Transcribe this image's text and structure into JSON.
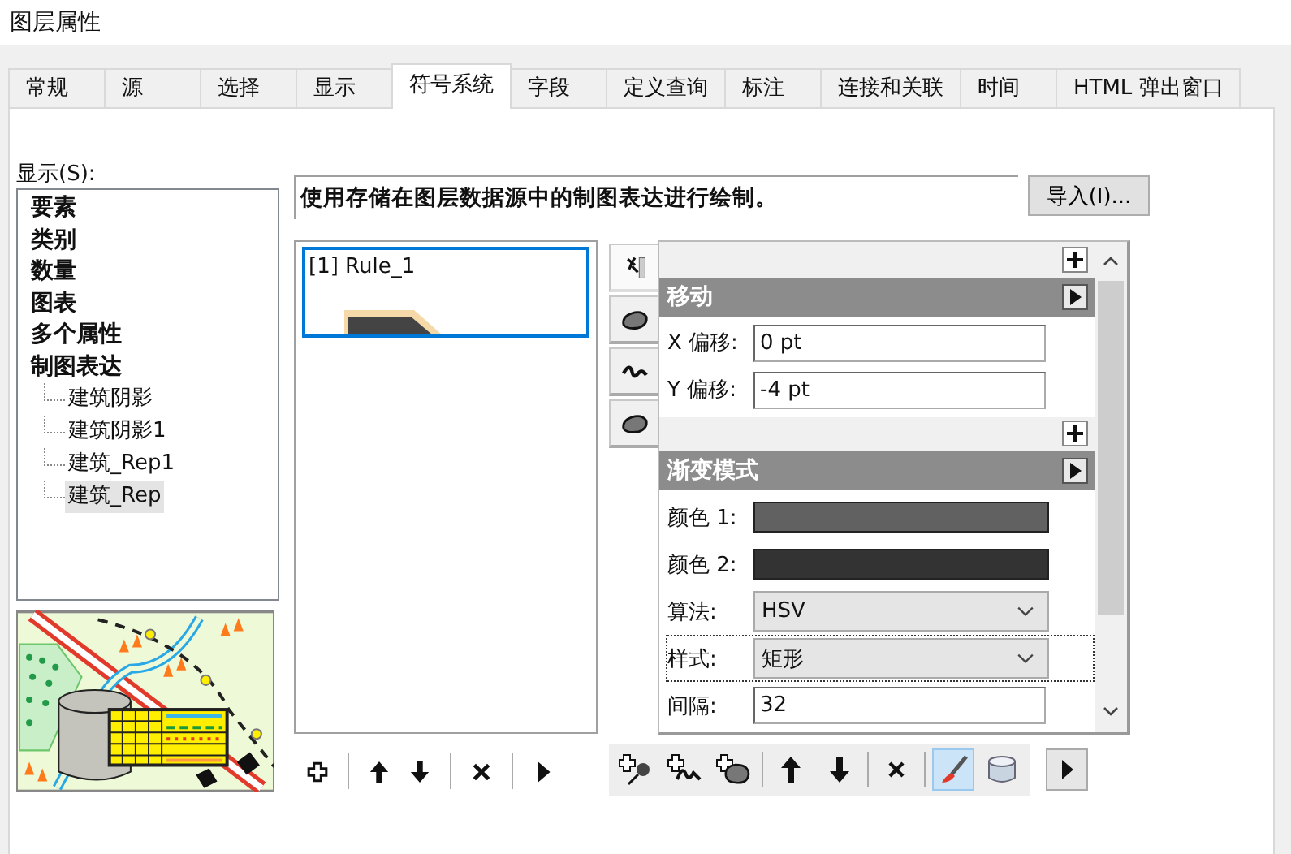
{
  "window": {
    "title": "图层属性"
  },
  "tabs": [
    {
      "label": "常规",
      "selected": false
    },
    {
      "label": "源",
      "selected": false
    },
    {
      "label": "选择",
      "selected": false
    },
    {
      "label": "显示",
      "selected": false
    },
    {
      "label": "符号系统",
      "selected": true
    },
    {
      "label": "字段",
      "selected": false
    },
    {
      "label": "定义查询",
      "selected": false
    },
    {
      "label": "标注",
      "selected": false
    },
    {
      "label": "连接和关联",
      "selected": false
    },
    {
      "label": "时间",
      "selected": false
    },
    {
      "label": "HTML 弹出窗口",
      "selected": false
    }
  ],
  "display": {
    "label": "显示(S):",
    "items": [
      {
        "label": "要素",
        "selected": false
      },
      {
        "label": "类别",
        "selected": false
      },
      {
        "label": "数量",
        "selected": false
      },
      {
        "label": "图表",
        "selected": false
      },
      {
        "label": "多个属性",
        "selected": false
      },
      {
        "label": "制图表达",
        "selected": false,
        "children": [
          {
            "label": "建筑阴影",
            "selected": false
          },
          {
            "label": "建筑阴影1",
            "selected": false
          },
          {
            "label": "建筑_Rep1",
            "selected": false
          },
          {
            "label": "建筑_Rep",
            "selected": true
          }
        ]
      }
    ]
  },
  "representation": {
    "description": "使用存储在图层数据源中的制图表达进行绘制。",
    "import_button": "导入(I)..."
  },
  "rules": [
    {
      "label": "[1] Rule_1",
      "selected": true
    }
  ],
  "side_tabs": [
    {
      "kind": "marker",
      "selected": true
    },
    {
      "kind": "fill",
      "selected": false
    },
    {
      "kind": "stroke",
      "selected": false
    },
    {
      "kind": "fill",
      "selected": false
    }
  ],
  "sections": [
    {
      "title": "移动",
      "fields": [
        {
          "kind": "text",
          "label": "X 偏移:",
          "value": "0 pt",
          "focused": false
        },
        {
          "kind": "text",
          "label": "Y 偏移:",
          "value": "-4 pt",
          "focused": false
        }
      ]
    },
    {
      "title": "渐变模式",
      "fields": [
        {
          "kind": "color",
          "label": "颜色 1:",
          "color": "#616161",
          "focused": false
        },
        {
          "kind": "color",
          "label": "颜色 2:",
          "color": "#333333",
          "focused": false
        },
        {
          "kind": "dropdown",
          "label": "算法:",
          "value": "HSV",
          "focused": false
        },
        {
          "kind": "dropdown",
          "label": "样式:",
          "value": "矩形",
          "focused": true
        },
        {
          "kind": "text",
          "label": "间隔:",
          "value": "32",
          "focused": false
        }
      ]
    }
  ],
  "symbol_toolbar": [
    {
      "kind": "add-marker",
      "pressed": false
    },
    {
      "kind": "add-stroke",
      "pressed": false
    },
    {
      "kind": "add-fill",
      "pressed": false
    },
    {
      "kind": "separator"
    },
    {
      "kind": "up",
      "pressed": false
    },
    {
      "kind": "down",
      "pressed": false
    },
    {
      "kind": "separator"
    },
    {
      "kind": "delete",
      "pressed": false
    },
    {
      "kind": "separator"
    },
    {
      "kind": "brush",
      "pressed": true
    },
    {
      "kind": "database",
      "pressed": false
    }
  ]
}
